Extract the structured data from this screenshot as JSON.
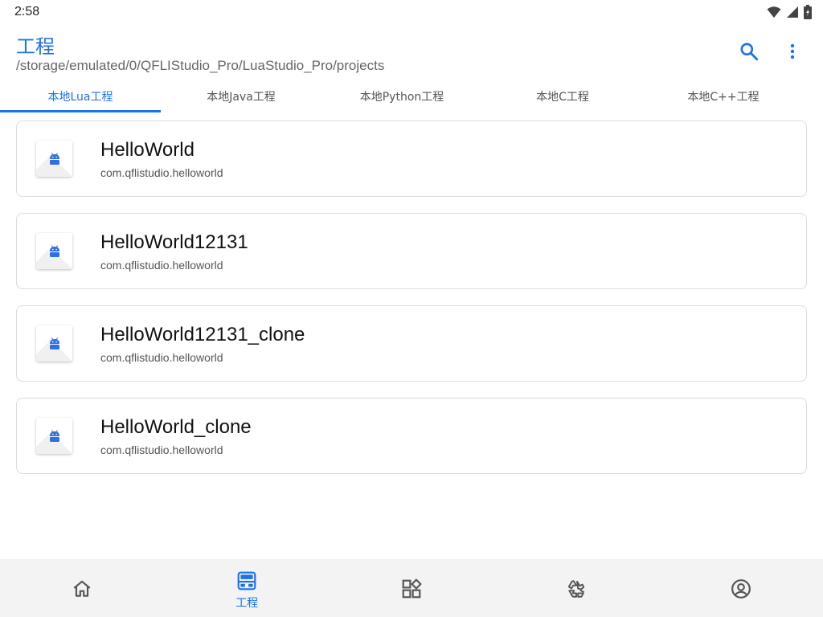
{
  "status_bar": {
    "time": "2:58",
    "icons": [
      "wifi-icon",
      "signal-icon",
      "battery-icon"
    ]
  },
  "app_bar": {
    "title": "工程",
    "path": "/storage/emulated/0/QFLIStudio_Pro/LuaStudio_Pro/projects",
    "actions": [
      "search-icon",
      "more-vert-icon"
    ]
  },
  "tabs": [
    {
      "label": "本地Lua工程",
      "active": true
    },
    {
      "label": "本地Java工程",
      "active": false
    },
    {
      "label": "本地Python工程",
      "active": false
    },
    {
      "label": "本地C工程",
      "active": false
    },
    {
      "label": "本地C++工程",
      "active": false
    }
  ],
  "projects": [
    {
      "name": "HelloWorld",
      "package": "com.qflistudio.helloworld",
      "icon": "android-icon"
    },
    {
      "name": "HelloWorld12131",
      "package": "com.qflistudio.helloworld",
      "icon": "android-icon"
    },
    {
      "name": "HelloWorld12131_clone",
      "package": "com.qflistudio.helloworld",
      "icon": "android-icon"
    },
    {
      "name": "HelloWorld_clone",
      "package": "com.qflistudio.helloworld",
      "icon": "android-icon"
    }
  ],
  "bottom_nav": [
    {
      "icon": "home-icon",
      "label": "",
      "active": false
    },
    {
      "icon": "projects-icon",
      "label": "工程",
      "active": true
    },
    {
      "icon": "widgets-icon",
      "label": "",
      "active": false
    },
    {
      "icon": "recycle-icon",
      "label": "",
      "active": false
    },
    {
      "icon": "account-icon",
      "label": "",
      "active": false
    }
  ],
  "colors": {
    "accent": "#1a73e8",
    "android_blue": "#2f6fe0",
    "nav_inactive": "#555555"
  }
}
